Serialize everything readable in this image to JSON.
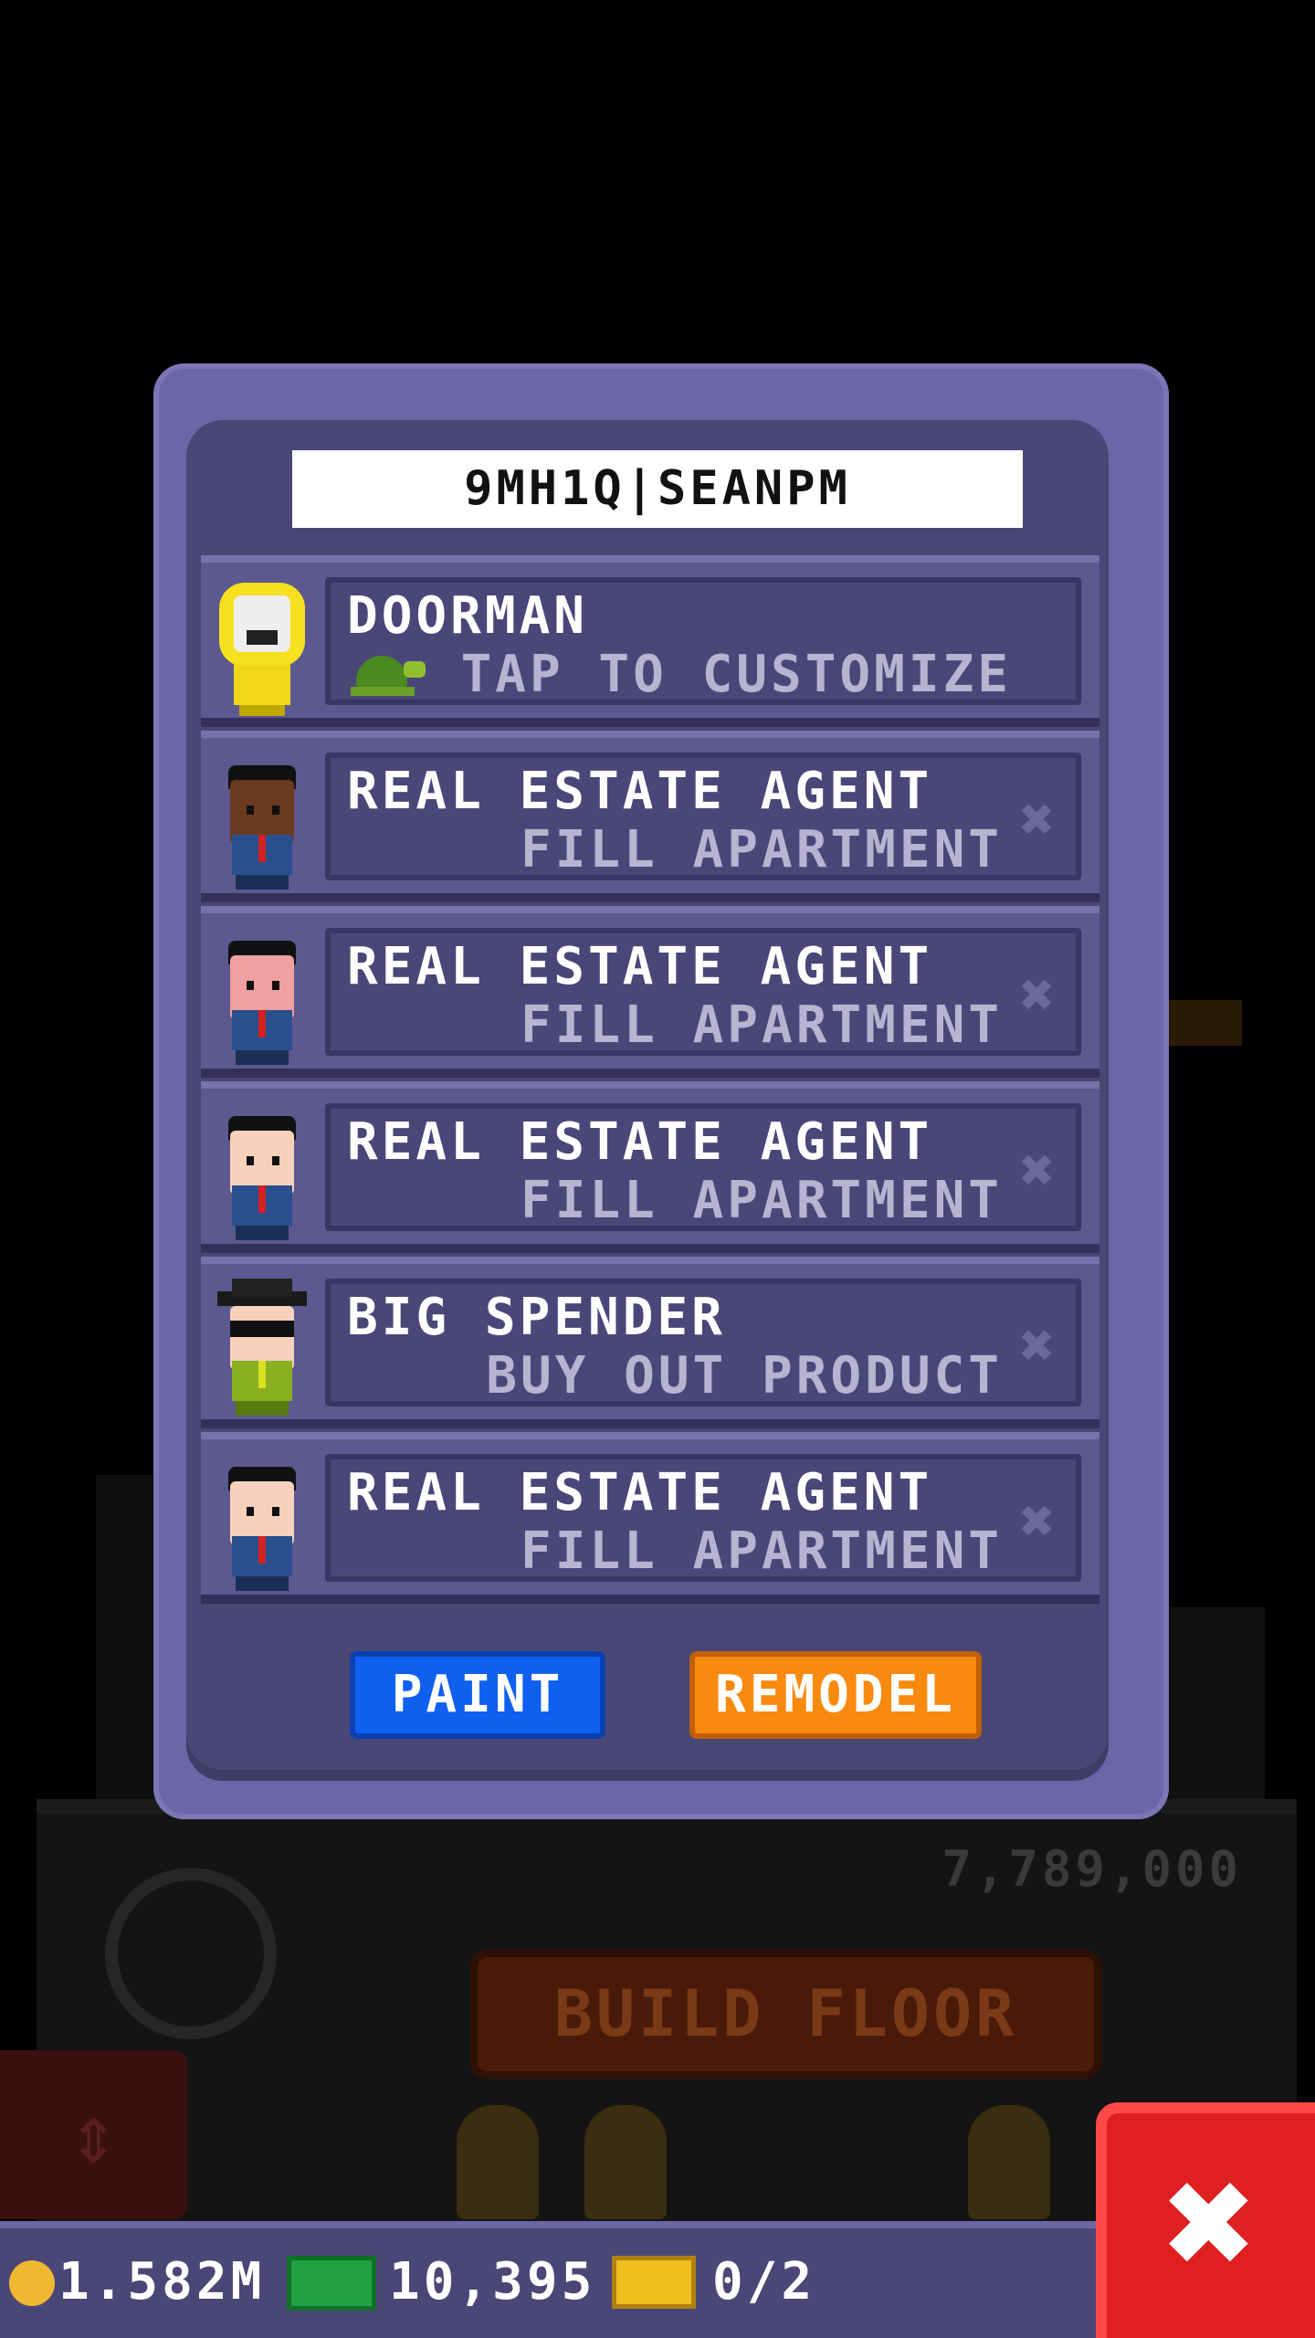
{
  "title_input": {
    "value": "9MH1Q|SEANPM"
  },
  "rows": [
    {
      "title": "DOORMAN",
      "subtitle": "TAP TO CUSTOMIZE",
      "has_pet": true,
      "pet_icon": "turtle-icon"
    },
    {
      "title": "REAL ESTATE AGENT",
      "subtitle": "FILL APARTMENT",
      "skin": "#6b3a1e"
    },
    {
      "title": "REAL ESTATE AGENT",
      "subtitle": "FILL APARTMENT",
      "skin": "#f0a0a0"
    },
    {
      "title": "REAL ESTATE AGENT",
      "subtitle": "FILL APARTMENT",
      "skin": "#f6d2bc"
    },
    {
      "title": "BIG SPENDER",
      "subtitle": "BUY OUT PRODUCT",
      "skin": "#f6d2bc"
    },
    {
      "title": "REAL ESTATE AGENT",
      "subtitle": "FILL APARTMENT",
      "skin": "#f6d2bc"
    }
  ],
  "buttons": {
    "paint": "PAINT",
    "remodel": "REMODEL"
  },
  "status_bar": {
    "coins": "1.582M",
    "bux": "10,395",
    "tickets": "0/2"
  },
  "background": {
    "build_floor": "BUILD FLOOR",
    "floor_cost": "7,789,000"
  },
  "close_icon_glyph": "✖",
  "colors": {
    "paint_button": "#1060f0",
    "remodel_button": "#f88a10",
    "close_button": "#e02020",
    "panel": "#4a4676"
  }
}
